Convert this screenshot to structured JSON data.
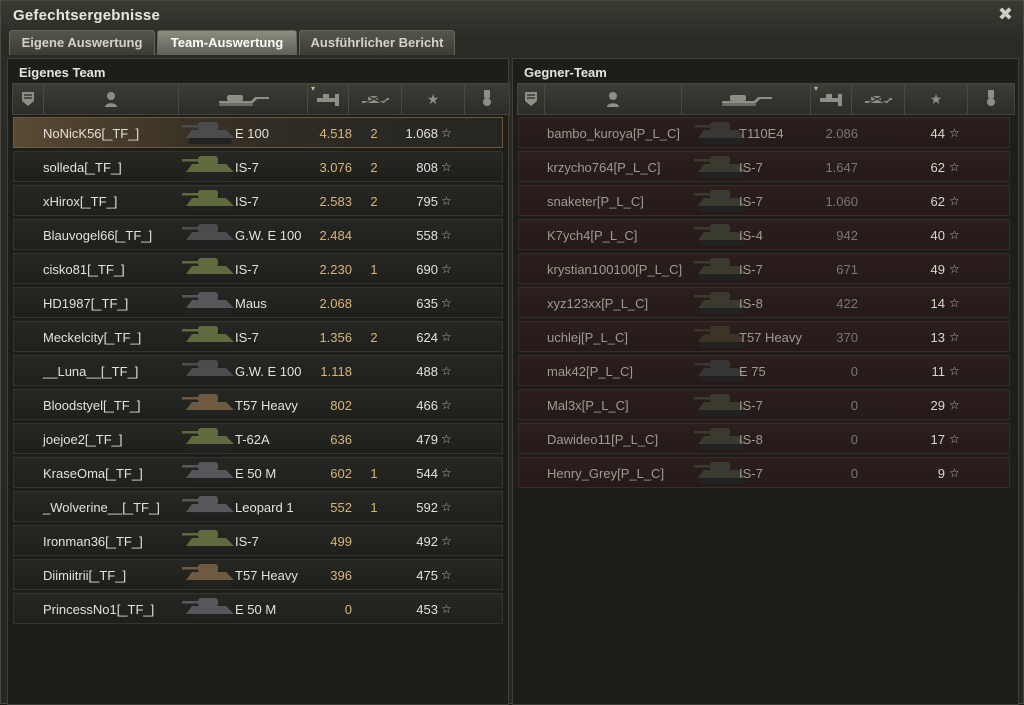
{
  "window": {
    "title": "Gefechtsergebnisse"
  },
  "tabs": [
    {
      "label": "Eigene Auswertung",
      "active": false
    },
    {
      "label": "Team-Auswertung",
      "active": true
    },
    {
      "label": "Ausführlicher Bericht",
      "active": false
    }
  ],
  "own_team": {
    "title": "Eigenes Team",
    "players": [
      {
        "name": "NoNicK56[_TF_]",
        "vehicle": "E 100",
        "damage": "4.518",
        "kills": "2",
        "xp": "1.068",
        "tank_color": "#4a4c4e",
        "self": true
      },
      {
        "name": "solleda[_TF_]",
        "vehicle": "IS-7",
        "damage": "3.076",
        "kills": "2",
        "xp": "808",
        "tank_color": "#5f6a3e"
      },
      {
        "name": "xHirox[_TF_]",
        "vehicle": "IS-7",
        "damage": "2.583",
        "kills": "2",
        "xp": "795",
        "tank_color": "#5f6a3e"
      },
      {
        "name": "Blauvogel66[_TF_]",
        "vehicle": "G.W. E 100",
        "damage": "2.484",
        "kills": "",
        "xp": "558",
        "tank_color": "#4a4c4e"
      },
      {
        "name": "cisko81[_TF_]",
        "vehicle": "IS-7",
        "damage": "2.230",
        "kills": "1",
        "xp": "690",
        "tank_color": "#5f6a3e"
      },
      {
        "name": "HD1987[_TF_]",
        "vehicle": "Maus",
        "damage": "2.068",
        "kills": "",
        "xp": "635",
        "tank_color": "#55575a"
      },
      {
        "name": "Meckelcity[_TF_]",
        "vehicle": "IS-7",
        "damage": "1.356",
        "kills": "2",
        "xp": "624",
        "tank_color": "#5f6a3e"
      },
      {
        "name": "__Luna__[_TF_]",
        "vehicle": "G.W. E 100",
        "damage": "1.118",
        "kills": "",
        "xp": "488",
        "tank_color": "#4a4c4e"
      },
      {
        "name": "Bloodstyel[_TF_]",
        "vehicle": "T57 Heavy",
        "damage": "802",
        "kills": "",
        "xp": "466",
        "tank_color": "#6d5a40"
      },
      {
        "name": "joejoe2[_TF_]",
        "vehicle": "T-62A",
        "damage": "636",
        "kills": "",
        "xp": "479",
        "tank_color": "#5f6a3e"
      },
      {
        "name": "KraseOma[_TF_]",
        "vehicle": "E 50 M",
        "damage": "602",
        "kills": "1",
        "xp": "544",
        "tank_color": "#55575a"
      },
      {
        "name": "_Wolverine__[_TF_]",
        "vehicle": "Leopard 1",
        "damage": "552",
        "kills": "1",
        "xp": "592",
        "tank_color": "#55575a"
      },
      {
        "name": "Ironman36[_TF_]",
        "vehicle": "IS-7",
        "damage": "499",
        "kills": "",
        "xp": "492",
        "tank_color": "#5f6a3e"
      },
      {
        "name": "Diimiitrii[_TF_]",
        "vehicle": "T57 Heavy",
        "damage": "396",
        "kills": "",
        "xp": "475",
        "tank_color": "#6d5a40"
      },
      {
        "name": "PrincessNo1[_TF_]",
        "vehicle": "E 50 M",
        "damage": "0",
        "kills": "",
        "xp": "453",
        "tank_color": "#55575a"
      }
    ]
  },
  "enemy_team": {
    "title": "Gegner-Team",
    "players": [
      {
        "name": "bambo_kuroya[P_L_C]",
        "vehicle": "T110E4",
        "damage": "2.086",
        "kills": "",
        "xp": "44",
        "tank_color": "#3a3632"
      },
      {
        "name": "krzycho764[P_L_C]",
        "vehicle": "IS-7",
        "damage": "1.647",
        "kills": "",
        "xp": "62",
        "tank_color": "#3a3a2e"
      },
      {
        "name": "snaketer[P_L_C]",
        "vehicle": "IS-7",
        "damage": "1.060",
        "kills": "",
        "xp": "62",
        "tank_color": "#3a3a2e"
      },
      {
        "name": "K7ych4[P_L_C]",
        "vehicle": "IS-4",
        "damage": "942",
        "kills": "",
        "xp": "40",
        "tank_color": "#3a3a2e"
      },
      {
        "name": "krystian100100[P_L_C]",
        "vehicle": "IS-7",
        "damage": "671",
        "kills": "",
        "xp": "49",
        "tank_color": "#3a3a2e"
      },
      {
        "name": "xyz123xx[P_L_C]",
        "vehicle": "IS-8",
        "damage": "422",
        "kills": "",
        "xp": "14",
        "tank_color": "#3a3a2e"
      },
      {
        "name": "uchlej[P_L_C]",
        "vehicle": "T57 Heavy",
        "damage": "370",
        "kills": "",
        "xp": "13",
        "tank_color": "#3d3428"
      },
      {
        "name": "mak42[P_L_C]",
        "vehicle": "E 75",
        "damage": "0",
        "kills": "",
        "xp": "11",
        "tank_color": "#363636"
      },
      {
        "name": "Mal3x[P_L_C]",
        "vehicle": "IS-7",
        "damage": "0",
        "kills": "",
        "xp": "29",
        "tank_color": "#3a3a2e"
      },
      {
        "name": "Dawideo11[P_L_C]",
        "vehicle": "IS-8",
        "damage": "0",
        "kills": "",
        "xp": "17",
        "tank_color": "#3a3a2e"
      },
      {
        "name": "Henry_Grey[P_L_C]",
        "vehicle": "IS-7",
        "damage": "0",
        "kills": "",
        "xp": "9",
        "tank_color": "#3a3a2e"
      }
    ]
  },
  "header_icons": [
    "rank-badge-icon",
    "player-icon",
    "tank-icon",
    "damage-icon",
    "kills-icon",
    "xp-star-icon",
    "medal-icon"
  ],
  "star_glyph": "☆",
  "sort_arrow_glyph": "▾"
}
